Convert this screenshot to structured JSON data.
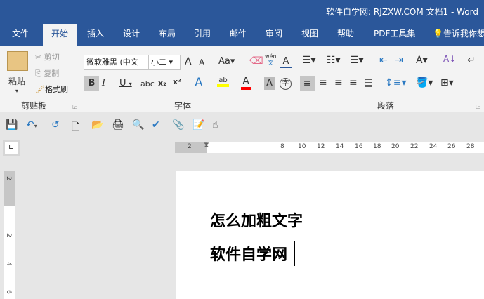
{
  "title": "软件自学网: RJZXW.COM   文档1  -  Word",
  "tabs": [
    "文件",
    "开始",
    "插入",
    "设计",
    "布局",
    "引用",
    "邮件",
    "审阅",
    "视图",
    "帮助",
    "PDF工具集",
    "告诉我你想"
  ],
  "clipboard": {
    "paste": "粘贴",
    "cut": "剪切",
    "copy": "复制",
    "format_painter": "格式刷",
    "label": "剪贴板"
  },
  "font": {
    "name": "微软雅黑 (中文",
    "size": "小二",
    "label": "字体",
    "bold": "B",
    "italic": "I",
    "underline": "U",
    "strike": "abc",
    "sub": "x₂",
    "sup": "x²",
    "case": "Aa",
    "grow": "A",
    "shrink": "A",
    "phonetic": "wén",
    "border": "A",
    "effects": "A",
    "highlight": "ab",
    "color": "A",
    "shade": "A",
    "enclose": "字",
    "highlight_color": "#ffff00",
    "font_color": "#ff0000"
  },
  "paragraph": {
    "label": "段落"
  },
  "ruler": {
    "h": [
      "2",
      "8",
      "10",
      "12",
      "14",
      "16",
      "18",
      "20",
      "22",
      "24",
      "26",
      "28"
    ],
    "v": [
      "2",
      "2",
      "4",
      "6"
    ]
  },
  "doc": {
    "line1": "怎么加粗文字",
    "line2": "软件自学网"
  },
  "colors": {
    "brand": "#2b579a"
  }
}
